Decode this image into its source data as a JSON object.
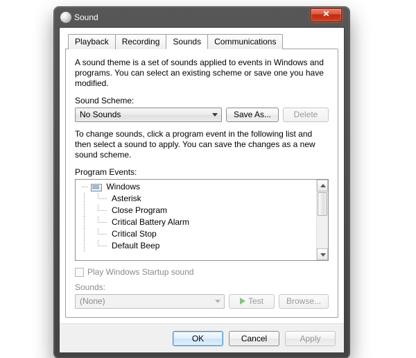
{
  "window": {
    "title": "Sound"
  },
  "tabs": {
    "playback": "Playback",
    "recording": "Recording",
    "sounds": "Sounds",
    "communications": "Communications",
    "active": "sounds"
  },
  "body": {
    "intro": "A sound theme is a set of sounds applied to events in Windows and programs.  You can select an existing scheme or save one you have modified.",
    "scheme_label": "Sound Scheme:",
    "scheme_value": "No Sounds",
    "save_as_label": "Save As...",
    "delete_label": "Delete",
    "events_intro": "To change sounds, click a program event in the following list and then select a sound to apply.  You can save the changes as a new sound scheme.",
    "events_label": "Program Events:",
    "events_root": "Windows",
    "events": [
      "Asterisk",
      "Close Program",
      "Critical Battery Alarm",
      "Critical Stop",
      "Default Beep"
    ],
    "startup_label": "Play Windows Startup sound",
    "sounds_label": "Sounds:",
    "sounds_value": "(None)",
    "test_label": "Test",
    "browse_label": "Browse..."
  },
  "footer": {
    "ok": "OK",
    "cancel": "Cancel",
    "apply": "Apply"
  }
}
